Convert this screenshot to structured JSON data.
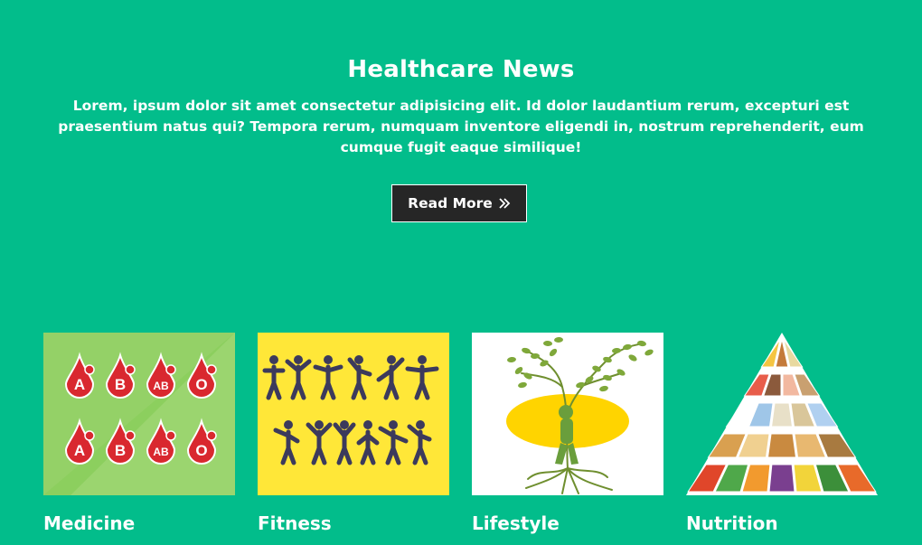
{
  "hero": {
    "title": "Healthcare News",
    "description": "Lorem, ipsum dolor sit amet consectetur adipisicing elit. Id dolor laudantium rerum, excepturi est praesentium natus qui? Tempora rerum, numquam inventore eligendi in, nostrum reprehenderit, eum cumque fugit eaque similique!",
    "button_label": "Read More"
  },
  "categories": [
    {
      "label": "Medicine",
      "icon": "blood-types-image",
      "blood_types": [
        "A",
        "B",
        "AB",
        "O"
      ]
    },
    {
      "label": "Fitness",
      "icon": "exercise-figures-image"
    },
    {
      "label": "Lifestyle",
      "icon": "yoga-tree-image"
    },
    {
      "label": "Nutrition",
      "icon": "food-pyramid-image"
    }
  ],
  "colors": {
    "background": "#02bd8b",
    "button": "#262626",
    "medicine_bg": "#8ccf5e",
    "fitness_bg": "#ffe738",
    "blood": "#d9282f"
  }
}
